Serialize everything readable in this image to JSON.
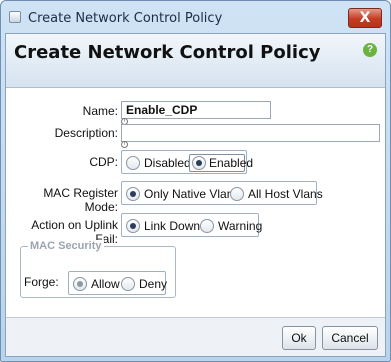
{
  "window": {
    "title": "Create Network Control Policy",
    "close_label": "X"
  },
  "header": {
    "title": "Create Network Control Policy",
    "help_label": "?"
  },
  "form": {
    "name": {
      "label": "Name:",
      "value": "Enable_CDP"
    },
    "description": {
      "label": "Description:",
      "value": ""
    },
    "cdp": {
      "label": "CDP:",
      "options": [
        "Disabled",
        "Enabled"
      ],
      "selected": "Enabled"
    },
    "mac_register_mode": {
      "label": "MAC Register Mode:",
      "options": [
        "Only Native Vlan",
        "All Host Vlans"
      ],
      "selected": "Only Native Vlan"
    },
    "action_on_uplink_fail": {
      "label": "Action on Uplink Fail:",
      "options": [
        "Link Down",
        "Warning"
      ],
      "selected": "Link Down"
    },
    "mac_security": {
      "legend": "MAC Security",
      "forge": {
        "label": "Forge:",
        "options": [
          "Allow",
          "Deny"
        ],
        "selected": "Allow"
      }
    }
  },
  "footer": {
    "ok_label": "Ok",
    "cancel_label": "Cancel"
  },
  "icons": {
    "app": "window-icon",
    "close": "close-icon",
    "help": "help-icon",
    "info": "info-icon"
  }
}
